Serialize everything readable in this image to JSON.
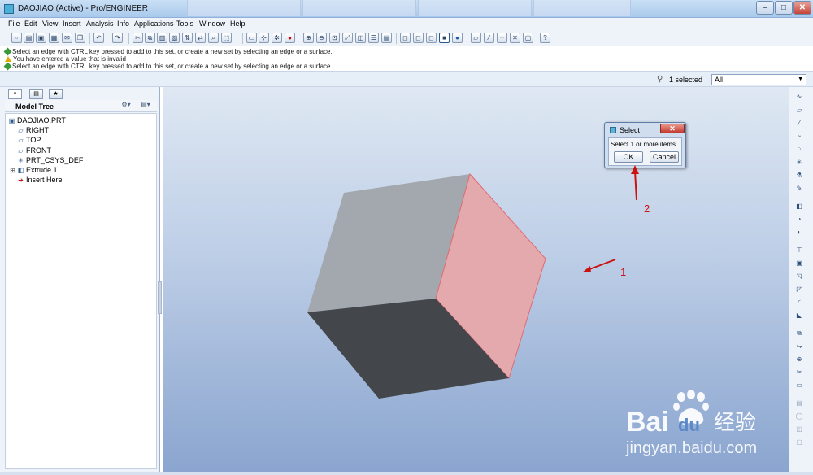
{
  "window": {
    "title": "DAOJIAO (Active) - Pro/ENGINEER",
    "controls": {
      "minimize": "–",
      "maximize": "□",
      "close": "✕"
    }
  },
  "menu": [
    "File",
    "Edit",
    "View",
    "Insert",
    "Analysis",
    "Info",
    "Applications",
    "Tools",
    "Window",
    "Help"
  ],
  "messages": [
    {
      "type": "ok",
      "text": "Select an edge with CTRL key pressed to add to this set, or create a new set by selecting an edge or a surface."
    },
    {
      "type": "warn",
      "text": "You have entered a value that is invalid"
    },
    {
      "type": "ok",
      "text": "Select an edge with CTRL key pressed to add to this set, or create a new set by selecting an edge or a surface."
    }
  ],
  "status": {
    "selected": "1 selected",
    "filter": "All"
  },
  "model_tree": {
    "title": "Model Tree",
    "items": [
      {
        "label": "DAOJIAO.PRT",
        "icon": "part-icon"
      },
      {
        "label": "RIGHT",
        "icon": "datum-plane-icon"
      },
      {
        "label": "TOP",
        "icon": "datum-plane-icon"
      },
      {
        "label": "FRONT",
        "icon": "datum-plane-icon"
      },
      {
        "label": "PRT_CSYS_DEF",
        "icon": "csys-icon"
      },
      {
        "label": "Extrude 1",
        "icon": "extrude-icon"
      },
      {
        "label": "Insert Here",
        "icon": "insert-arrow-icon"
      }
    ]
  },
  "select_dialog": {
    "title": "Select",
    "message": "Select 1 or more items.",
    "ok": "OK",
    "cancel": "Cancel"
  },
  "annotations": [
    "1",
    "2"
  ],
  "watermark": {
    "logo": "Bai du 经验",
    "url": "jingyan.baidu.com"
  },
  "colors": {
    "highlight_face": "#e3a9ad",
    "highlight_edge": "#e06a72",
    "annotation": "#cc1111"
  }
}
